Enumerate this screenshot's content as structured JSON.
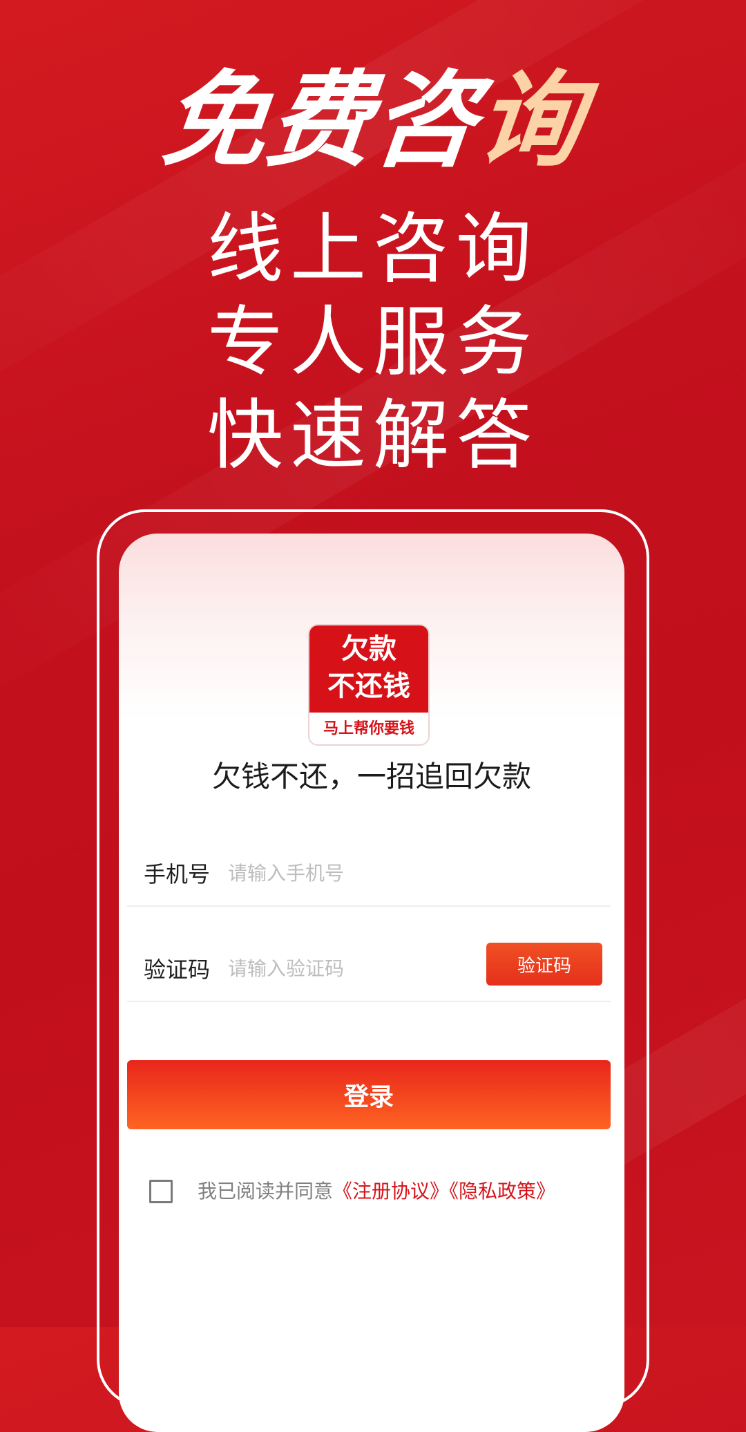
{
  "hero": {
    "title_main": "免费咨",
    "title_accent": "询"
  },
  "taglines": [
    "线上咨询",
    "专人服务",
    "快速解答"
  ],
  "app": {
    "logo_line1": "欠款",
    "logo_line2": "不还钱",
    "logo_bottom": "马上帮你要钱",
    "slogan": "欠钱不还，一招追回欠款"
  },
  "form": {
    "phone_label": "手机号",
    "phone_placeholder": "请输入手机号",
    "code_label": "验证码",
    "code_placeholder": "请输入验证码",
    "code_button": "验证码",
    "login_button": "登录"
  },
  "agreement": {
    "prefix": "我已阅读并同意",
    "terms_link": "《注册协议》",
    "privacy_link": "《隐私政策》"
  },
  "colors": {
    "background": "#c4111e",
    "accent_text": "#fbd3a6",
    "button_orange": "#fe6423",
    "link_red": "#d6141b"
  }
}
